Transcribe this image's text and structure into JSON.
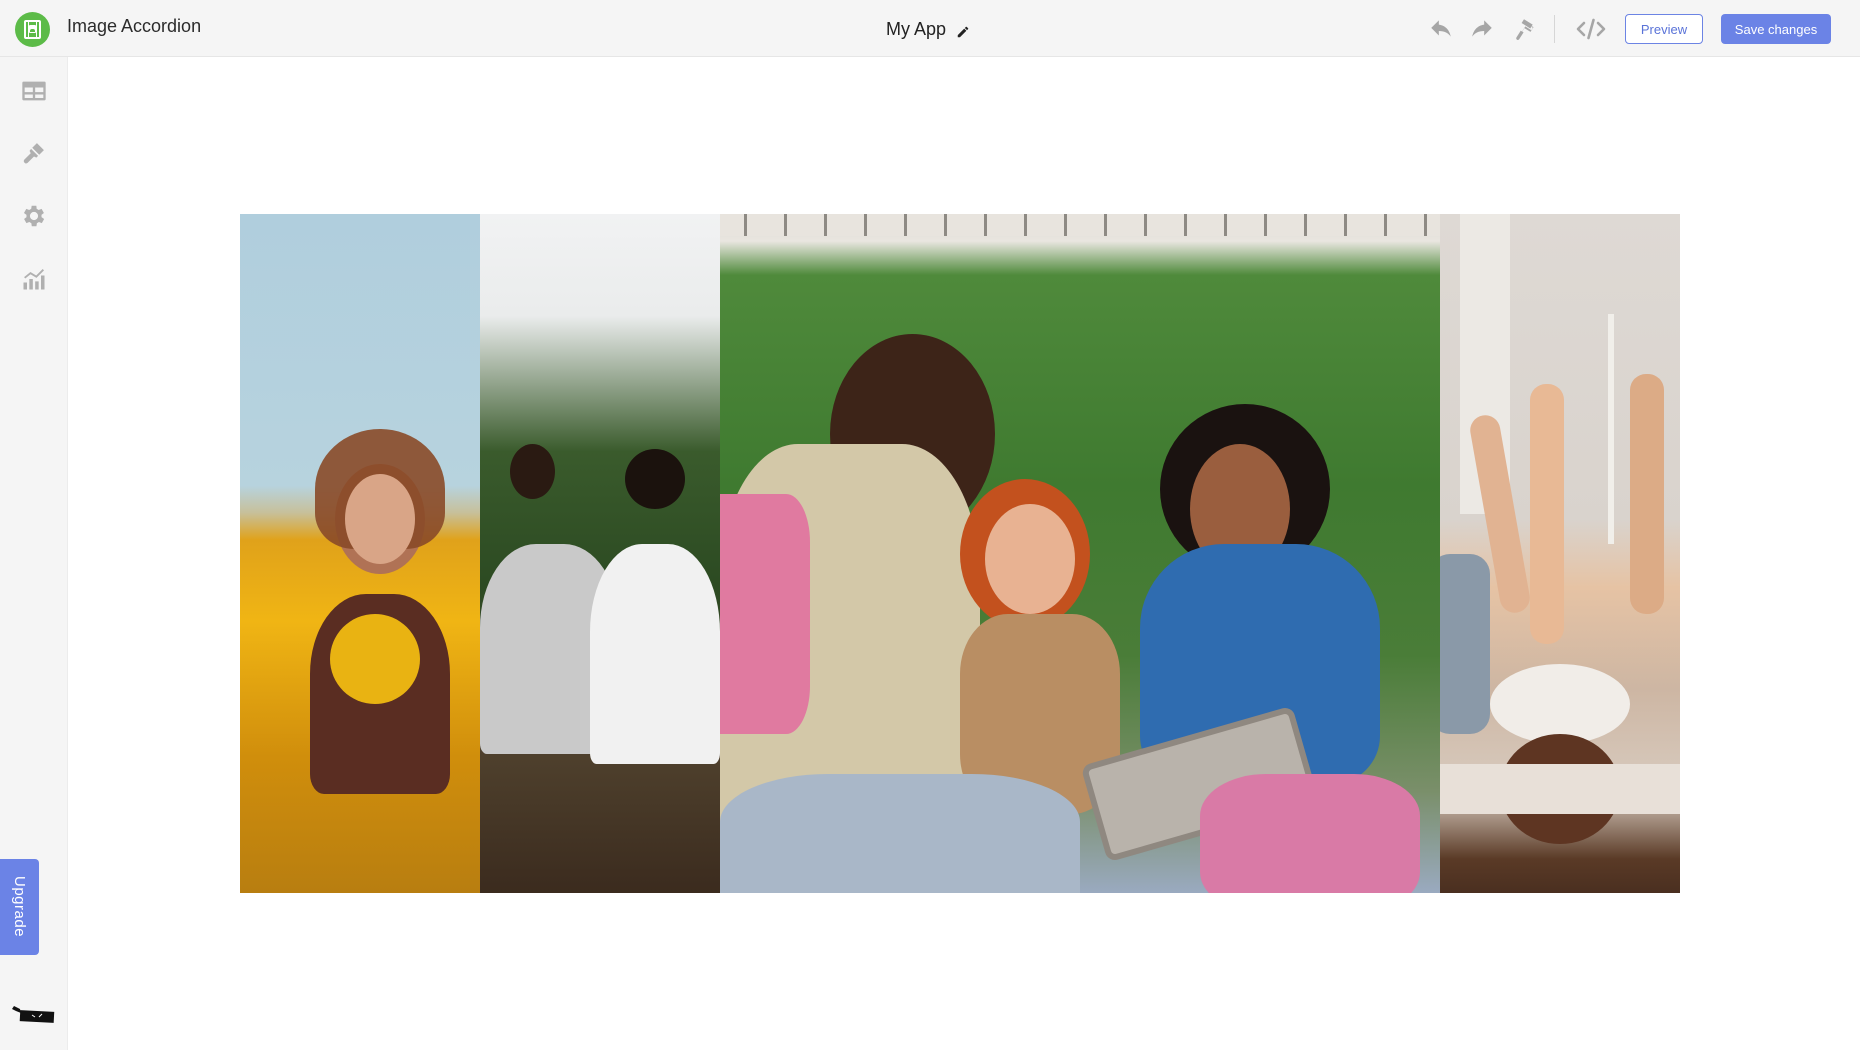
{
  "header": {
    "app_name": "Image Accordion",
    "project_title": "My App",
    "icons": {
      "logo": "image-accordion-logo",
      "edit": "pencil-icon",
      "undo": "undo-icon",
      "redo": "redo-icon",
      "theme": "paint-roller-icon",
      "code": "code-icon"
    },
    "preview_label": "Preview",
    "save_label": "Save changes"
  },
  "sidebar": {
    "items": [
      {
        "name": "content",
        "icon": "table-layout-icon"
      },
      {
        "name": "design",
        "icon": "paintbrush-icon"
      },
      {
        "name": "settings",
        "icon": "gear-icon"
      },
      {
        "name": "analytics",
        "icon": "chart-icon"
      }
    ],
    "upgrade_label": "Upgrade"
  },
  "accordion": {
    "panels": [
      {
        "description": "Woman smiling in sunflower field",
        "expanded": false
      },
      {
        "description": "Two men sitting on grassy hillside",
        "expanded": false
      },
      {
        "description": "Friends laughing in front of ivy wall with tablet",
        "expanded": true
      },
      {
        "description": "Friends lying on bed with legs up on wall",
        "expanded": false
      }
    ]
  },
  "colors": {
    "accent": "#6b83e6",
    "logo_green": "#5cbb48",
    "icon_gray": "#a6a6a6",
    "header_bg": "#f5f5f5"
  }
}
